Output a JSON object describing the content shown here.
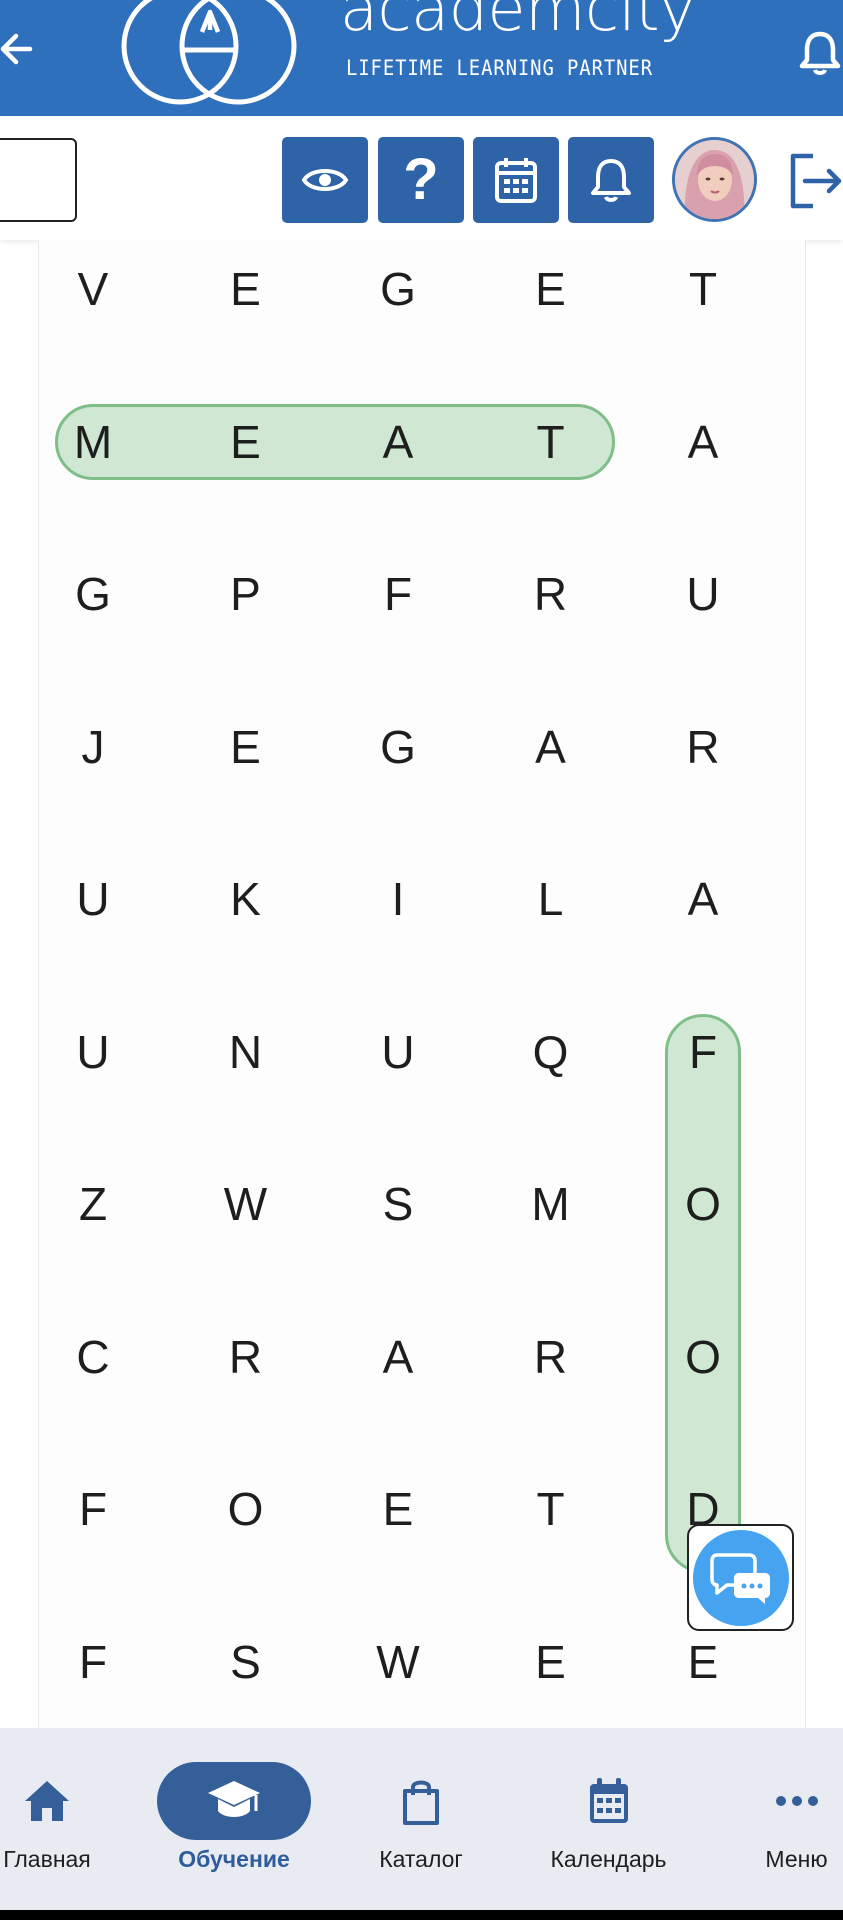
{
  "app": {
    "brand_name": "academcity",
    "tagline": "LIFETIME LEARNING PARTNER"
  },
  "colors": {
    "header": "#2f70bd",
    "toolbar_button": "#2f63a8",
    "highlight": "#96cda0",
    "nav_background": "#e9ebf2",
    "nav_active": "#355f98",
    "chat": "#45a3f0"
  },
  "icons": {
    "back": "arrow-left-icon",
    "header_bell": "bell-icon",
    "visibility": "eye-icon",
    "help": "question-icon",
    "calendar": "calendar-icon",
    "notifications": "bell-icon",
    "logout": "logout-icon",
    "chat": "chat-bubbles-icon"
  },
  "toolbar": {
    "help_label": "?"
  },
  "puzzle": {
    "grid": [
      [
        "V",
        "E",
        "G",
        "E",
        "T"
      ],
      [
        "M",
        "E",
        "A",
        "T",
        "A"
      ],
      [
        "G",
        "P",
        "F",
        "R",
        "U"
      ],
      [
        "J",
        "E",
        "G",
        "A",
        "R"
      ],
      [
        "U",
        "K",
        "I",
        "L",
        "A"
      ],
      [
        "U",
        "N",
        "U",
        "Q",
        "F"
      ],
      [
        "Z",
        "W",
        "S",
        "M",
        "O"
      ],
      [
        "C",
        "R",
        "A",
        "R",
        "O"
      ],
      [
        "F",
        "O",
        "E",
        "T",
        "D"
      ],
      [
        "F",
        "S",
        "W",
        "E",
        "E"
      ]
    ],
    "found_words": [
      {
        "word": "MEAT",
        "start": [
          1,
          0
        ],
        "end": [
          1,
          3
        ]
      },
      {
        "word": "FOOD",
        "start": [
          5,
          4
        ],
        "end": [
          8,
          4
        ]
      }
    ]
  },
  "nav": {
    "items": [
      {
        "label": "Главная",
        "icon": "home-icon",
        "active": false
      },
      {
        "label": "Обучение",
        "icon": "graduation-cap-icon",
        "active": true
      },
      {
        "label": "Каталог",
        "icon": "shopping-bag-icon",
        "active": false
      },
      {
        "label": "Календарь",
        "icon": "calendar-icon",
        "active": false
      },
      {
        "label": "Меню",
        "icon": "more-dots-icon",
        "active": false
      }
    ]
  }
}
